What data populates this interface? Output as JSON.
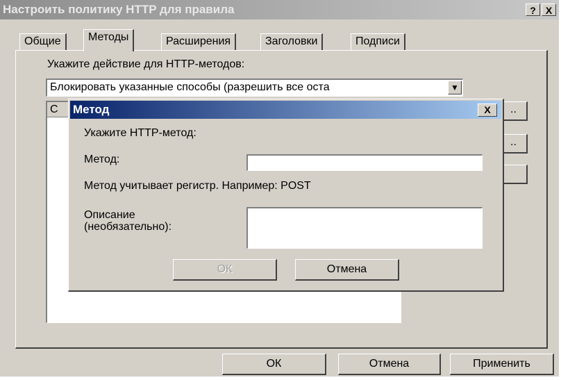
{
  "window": {
    "title": "Настроить политику HTTP для правила",
    "help_label": "?",
    "close_label": "X"
  },
  "tabs": [
    {
      "label": "Общие"
    },
    {
      "label": "Методы"
    },
    {
      "label": "Расширения"
    },
    {
      "label": "Заголовки"
    },
    {
      "label": "Подписи"
    }
  ],
  "methods_tab": {
    "action_prompt": "Укажите действие для HTTP-методов:",
    "action_selected": "Блокировать указанные способы (разрешить все оста",
    "dropdown_arrow": "▼",
    "list_header": "С",
    "side_buttons": [
      "..",
      "..",
      ""
    ]
  },
  "dialog": {
    "title": "Метод",
    "close_label": "X",
    "prompt": "Укажите HTTP-метод:",
    "method_label": "Метод:",
    "method_value": "",
    "hint": "Метод учитывает регистр. Например: POST",
    "description_label_line1": "Описание",
    "description_label_line2": "(необязательно):",
    "description_value": "",
    "ok_label": "ОК",
    "cancel_label": "Отмена"
  },
  "footer": {
    "ok_label": "ОК",
    "cancel_label": "Отмена",
    "apply_label": "Применить"
  }
}
